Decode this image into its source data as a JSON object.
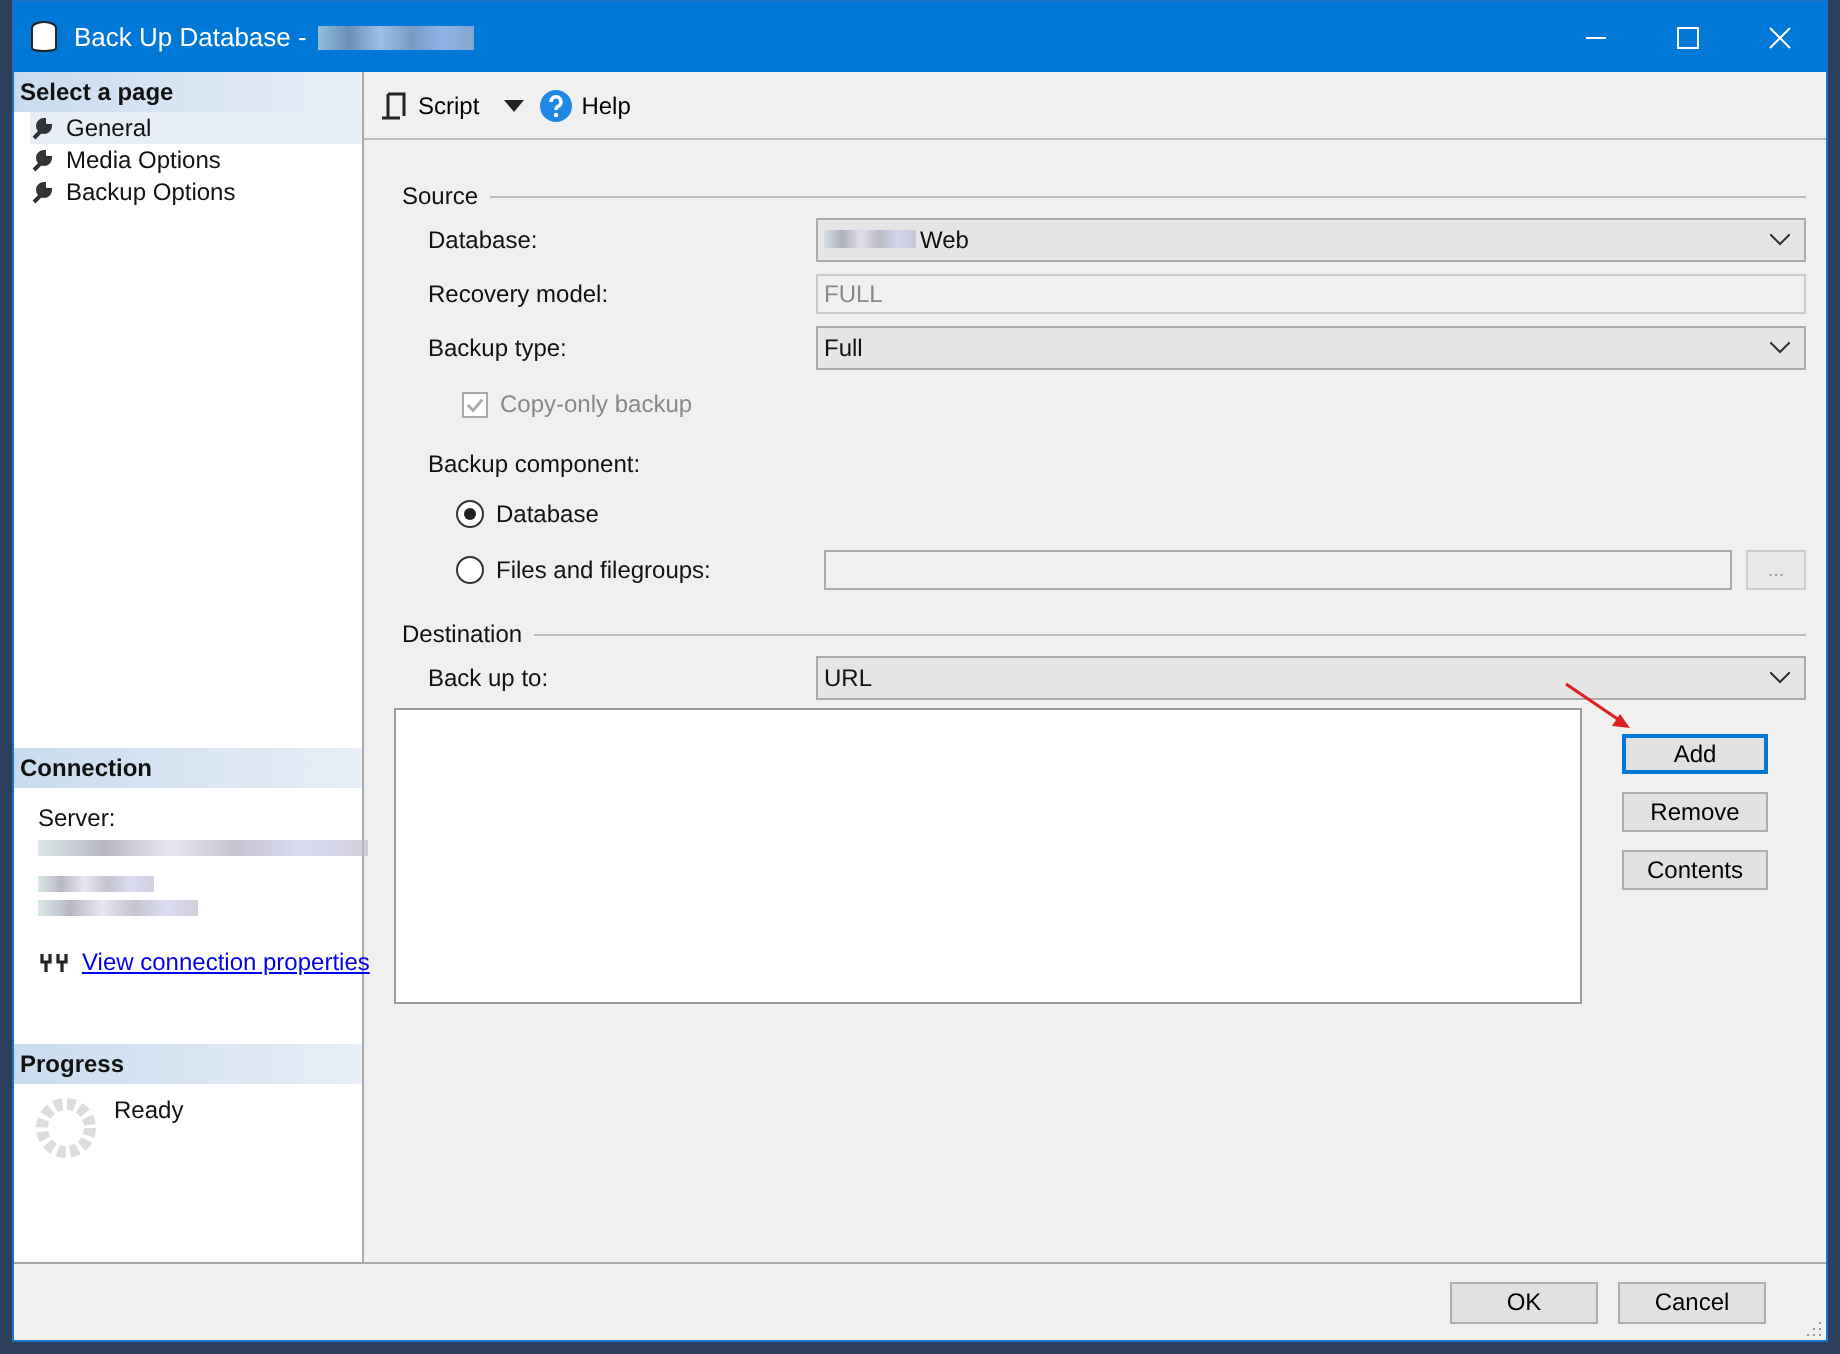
{
  "window": {
    "title": "Back Up Database -",
    "redacted_title": true
  },
  "sidebar": {
    "heading": "Select a page",
    "items": [
      {
        "label": "General",
        "selected": true
      },
      {
        "label": "Media Options",
        "selected": false
      },
      {
        "label": "Backup Options",
        "selected": false
      }
    ]
  },
  "connection": {
    "heading": "Connection",
    "server_label": "Server:",
    "link": "View connection properties"
  },
  "progress": {
    "heading": "Progress",
    "status": "Ready"
  },
  "toolbar": {
    "script": "Script",
    "help": "Help"
  },
  "source": {
    "heading": "Source",
    "database_label": "Database:",
    "database_value": "Web",
    "recovery_label": "Recovery model:",
    "recovery_value": "FULL",
    "backup_type_label": "Backup type:",
    "backup_type_value": "Full",
    "copy_only": {
      "label": "Copy-only backup",
      "checked": true,
      "disabled": true
    },
    "component_label": "Backup component:",
    "components": [
      {
        "label": "Database",
        "selected": true
      },
      {
        "label": "Files and filegroups:",
        "selected": false
      }
    ],
    "browse": "..."
  },
  "destination": {
    "heading": "Destination",
    "backup_to_label": "Back up to:",
    "backup_to_value": "URL",
    "buttons": [
      {
        "label": "Add",
        "focused": true
      },
      {
        "label": "Remove",
        "focused": false
      },
      {
        "label": "Contents",
        "focused": false
      }
    ]
  },
  "footer": {
    "buttons": [
      "OK",
      "Cancel"
    ]
  }
}
